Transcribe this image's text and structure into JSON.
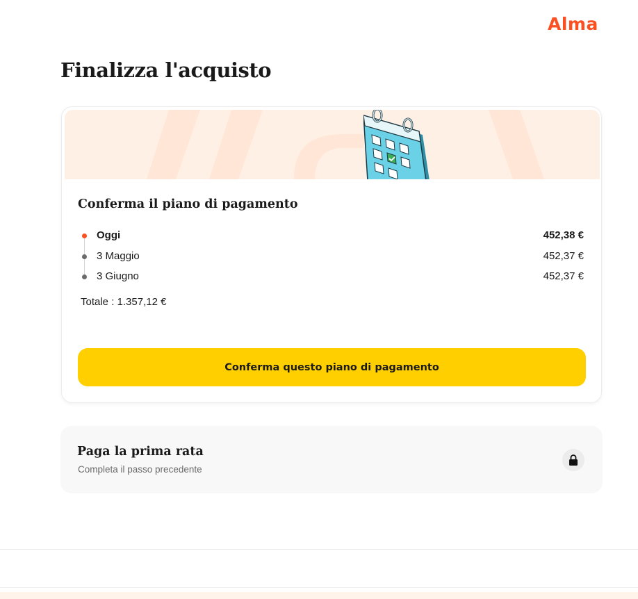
{
  "brand": {
    "logo_text": "Alma",
    "accent": "#fa5022",
    "cta_color": "#ffcf00"
  },
  "page": {
    "title": "Finalizza l'acquisto"
  },
  "payment_card": {
    "title": "Conferma il piano di pagamento",
    "installments": [
      {
        "label": "Oggi",
        "amount": "452,38 €",
        "active": true
      },
      {
        "label": "3 Maggio",
        "amount": "452,37 €",
        "active": false
      },
      {
        "label": "3 Giugno",
        "amount": "452,37 €",
        "active": false
      }
    ],
    "total": "Totale : 1.357,12 €",
    "cta_label": "Conferma questo piano di pagamento",
    "illustration": "calendar-icon"
  },
  "next_step": {
    "title": "Paga la prima rata",
    "subtitle": "Completa il passo precedente",
    "icon": "lock-icon"
  }
}
